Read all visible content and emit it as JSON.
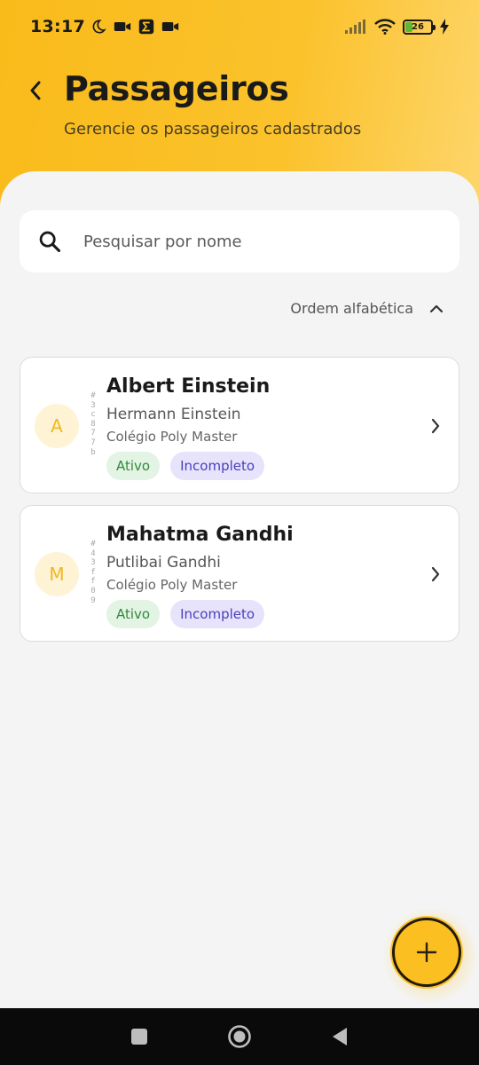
{
  "status_bar": {
    "time": "13:17",
    "battery_level": "26"
  },
  "header": {
    "title": "Passageiros",
    "subtitle": "Gerencie os passageiros cadastrados"
  },
  "search": {
    "placeholder": "Pesquisar por nome",
    "value": ""
  },
  "sort": {
    "label": "Ordem alfabética"
  },
  "passengers": [
    {
      "initial": "A",
      "id": "#3c877b",
      "name": "Albert Einstein",
      "parent": "Hermann Einstein",
      "school": "Colégio Poly Master",
      "status": "Ativo",
      "completeness": "Incompleto"
    },
    {
      "initial": "M",
      "id": "#43ff09",
      "name": "Mahatma Gandhi",
      "parent": "Putlibai Gandhi",
      "school": "Colégio Poly Master",
      "status": "Ativo",
      "completeness": "Incompleto"
    }
  ],
  "colors": {
    "accent": "#fbbf22",
    "status_active": "#2e8b3a",
    "status_incomplete": "#4a3fbd"
  },
  "icons": {
    "back": "chevron-left-icon",
    "search": "search-icon",
    "sort": "chevron-up-icon",
    "row": "chevron-right-icon",
    "fab": "plus-icon"
  }
}
